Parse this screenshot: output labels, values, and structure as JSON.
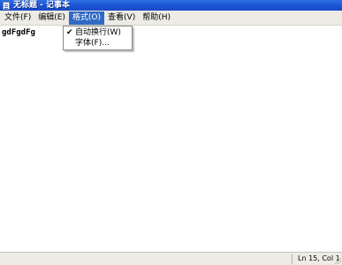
{
  "window": {
    "title": "无标题 - 记事本",
    "icon": "notepad-icon"
  },
  "menubar": {
    "items": [
      {
        "label": "文件(F)"
      },
      {
        "label": "编辑(E)"
      },
      {
        "label": "格式(O)"
      },
      {
        "label": "查看(V)"
      },
      {
        "label": "帮助(H)"
      }
    ],
    "active_index": 2
  },
  "format_menu": {
    "items": [
      {
        "label": "自动换行(W)",
        "checked": true
      },
      {
        "label": "字体(F)..."
      }
    ]
  },
  "editor": {
    "content": "gdFgdFg"
  },
  "statusbar": {
    "position": "Ln 15, Col 1"
  },
  "colors": {
    "titlebar": "#1c56d6",
    "menu_highlight": "#316ac5",
    "chrome": "#ecebe4"
  }
}
